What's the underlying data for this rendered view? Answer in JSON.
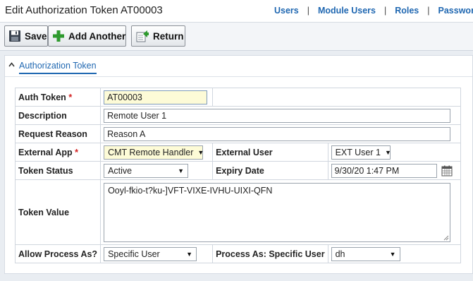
{
  "header": {
    "title": "Edit Authorization Token AT00003",
    "nav": [
      "Users",
      "Module Users",
      "Roles",
      "Password V"
    ]
  },
  "toolbar": {
    "save_label": "Save",
    "add_another_label": "Add Another",
    "return_label": "Return"
  },
  "section": {
    "title": "Authorization Token"
  },
  "form": {
    "auth_token": {
      "label": "Auth Token",
      "required_marker": "*",
      "value": "AT00003"
    },
    "description": {
      "label": "Description",
      "value": "Remote User 1"
    },
    "request_reason": {
      "label": "Request Reason",
      "value": "Reason A"
    },
    "external_app": {
      "label": "External App",
      "required_marker": "*",
      "value": "CMT Remote Handler"
    },
    "external_user": {
      "label": "External User",
      "value": "EXT User 1"
    },
    "token_status": {
      "label": "Token Status",
      "value": "Active"
    },
    "expiry_date": {
      "label": "Expiry Date",
      "value": "9/30/20 1:47 PM"
    },
    "token_value": {
      "label": "Token Value",
      "value": "Ooyl-fkio-t?ku-]VFT-VIXE-IVHU-UIXI-QFN"
    },
    "allow_process_as": {
      "label": "Allow Process As?",
      "value": "Specific User"
    },
    "process_as_specific_user": {
      "label": "Process As: Specific User",
      "value": "dh"
    }
  },
  "colors": {
    "link": "#1f67b1",
    "required": "#d21f1f",
    "highlight_field": "#fdfbd7",
    "plus_green": "#2e9a2e"
  },
  "icons": [
    "save-icon",
    "add-icon",
    "return-icon",
    "collapse-icon",
    "calendar-icon"
  ]
}
